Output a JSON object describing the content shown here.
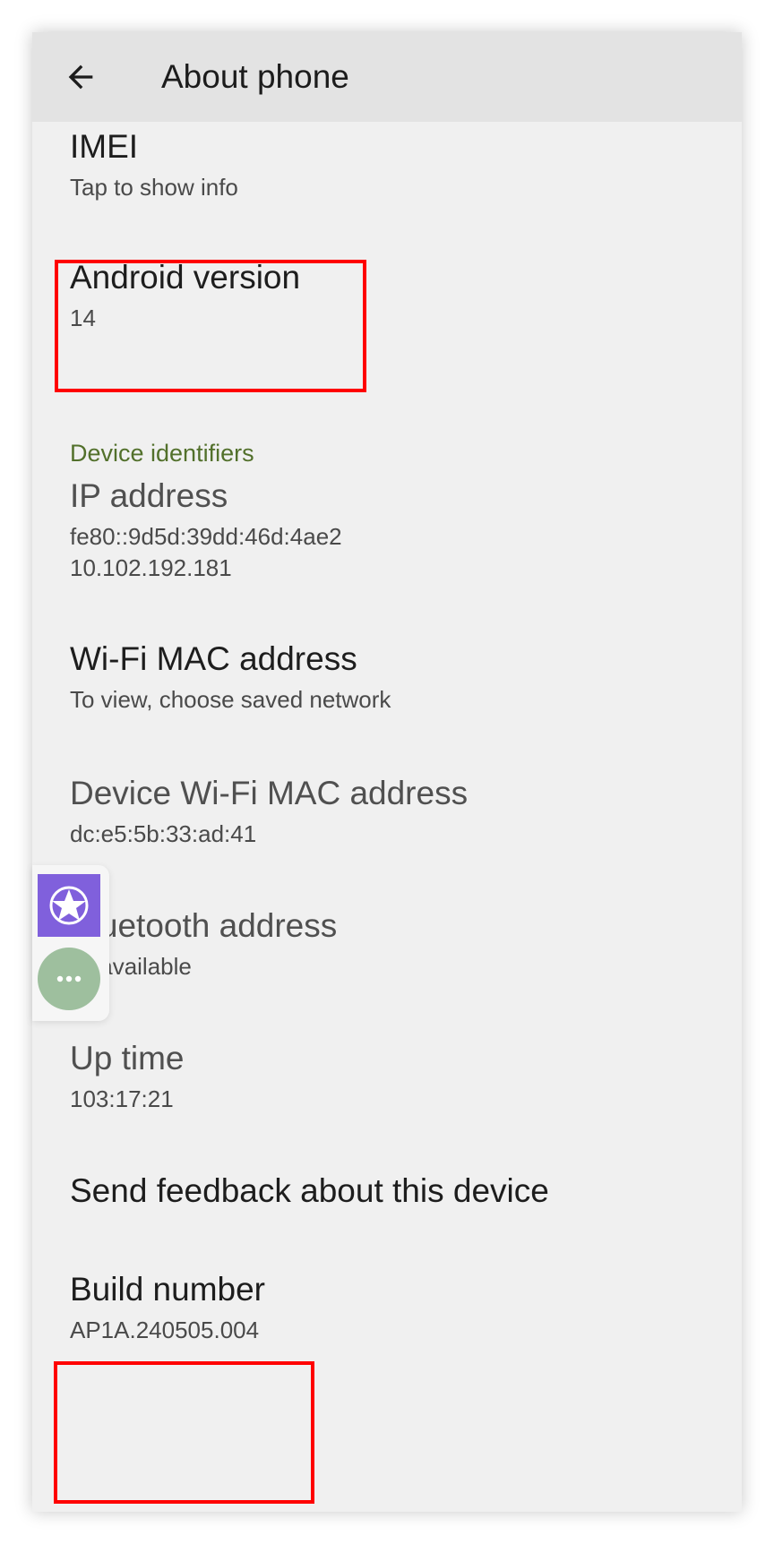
{
  "header": {
    "title": "About phone",
    "back_icon": "arrow-back-icon"
  },
  "items": {
    "imei": {
      "title": "IMEI",
      "sub": "Tap to show info"
    },
    "android_version": {
      "title": "Android version",
      "sub": "14"
    },
    "section_label": "Device identifiers",
    "ip_address": {
      "title": "IP address",
      "sub1": "fe80::9d5d:39dd:46d:4ae2",
      "sub2": "10.102.192.181"
    },
    "wifi_mac": {
      "title": "Wi-Fi MAC address",
      "sub": "To view, choose saved network"
    },
    "device_wifi_mac": {
      "title": "Device Wi-Fi MAC address",
      "sub": "dc:e5:5b:33:ad:41"
    },
    "bluetooth": {
      "title": "Bluetooth address",
      "sub": "Unavailable"
    },
    "uptime": {
      "title": "Up time",
      "sub": "103:17:21"
    },
    "feedback": {
      "title": "Send feedback about this device"
    },
    "build_number": {
      "title": "Build number",
      "sub": "AP1A.240505.004"
    }
  },
  "overlay": {
    "star_icon": "star-icon",
    "more_icon": "more-horiz-icon"
  },
  "colors": {
    "accent_section": "#52702b",
    "highlight": "#ff0000",
    "star_button": "#8060dc",
    "more_button": "#9ebf9e"
  }
}
